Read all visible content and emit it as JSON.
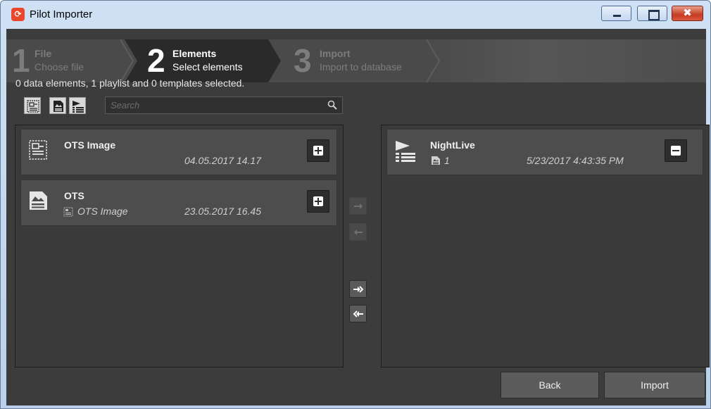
{
  "window": {
    "title": "Pilot Importer",
    "app_icon": "pilot-logo-icon",
    "controls": [
      "minimize-icon",
      "maximize-icon",
      "close-icon"
    ],
    "close_glyph": "✖"
  },
  "wizard": {
    "steps": [
      {
        "number": "1",
        "title": "File",
        "subtitle": "Choose file",
        "state": "done"
      },
      {
        "number": "2",
        "title": "Elements",
        "subtitle": "Select elements",
        "state": "active"
      },
      {
        "number": "3",
        "title": "Import",
        "subtitle": "Import to database",
        "state": "pending"
      }
    ]
  },
  "summary": "0 data elements, 1 playlist and 0 templates selected.",
  "filter_toolbar": {
    "buttons": [
      "template-filter-icon",
      "data-element-filter-icon",
      "playlist-filter-icon"
    ],
    "search_placeholder": "Search",
    "search_value": ""
  },
  "available_list": [
    {
      "name": "OTS Image",
      "subtitle": "",
      "date": "04.05.2017 14.17",
      "icon": "template-icon",
      "action": "add"
    },
    {
      "name": "OTS",
      "subtitle": "OTS Image",
      "date": "23.05.2017 16.45",
      "icon": "data-element-icon",
      "action": "add"
    }
  ],
  "selected_list": [
    {
      "name": "NightLive",
      "count": "1",
      "date": "5/23/2017 4:43:35 PM",
      "icon": "playlist-icon",
      "action": "remove"
    }
  ],
  "transfer_buttons": [
    {
      "name": "move-right-icon",
      "enabled": false
    },
    {
      "name": "move-left-icon",
      "enabled": false
    },
    {
      "name": "move-all-right-icon",
      "enabled": true
    },
    {
      "name": "move-all-left-icon",
      "enabled": true
    }
  ],
  "footer": {
    "back_label": "Back",
    "import_label": "Import"
  },
  "colors": {
    "accent": "#e8472b",
    "background": "#3c3c3c",
    "active_step": "#2a2a2a"
  }
}
